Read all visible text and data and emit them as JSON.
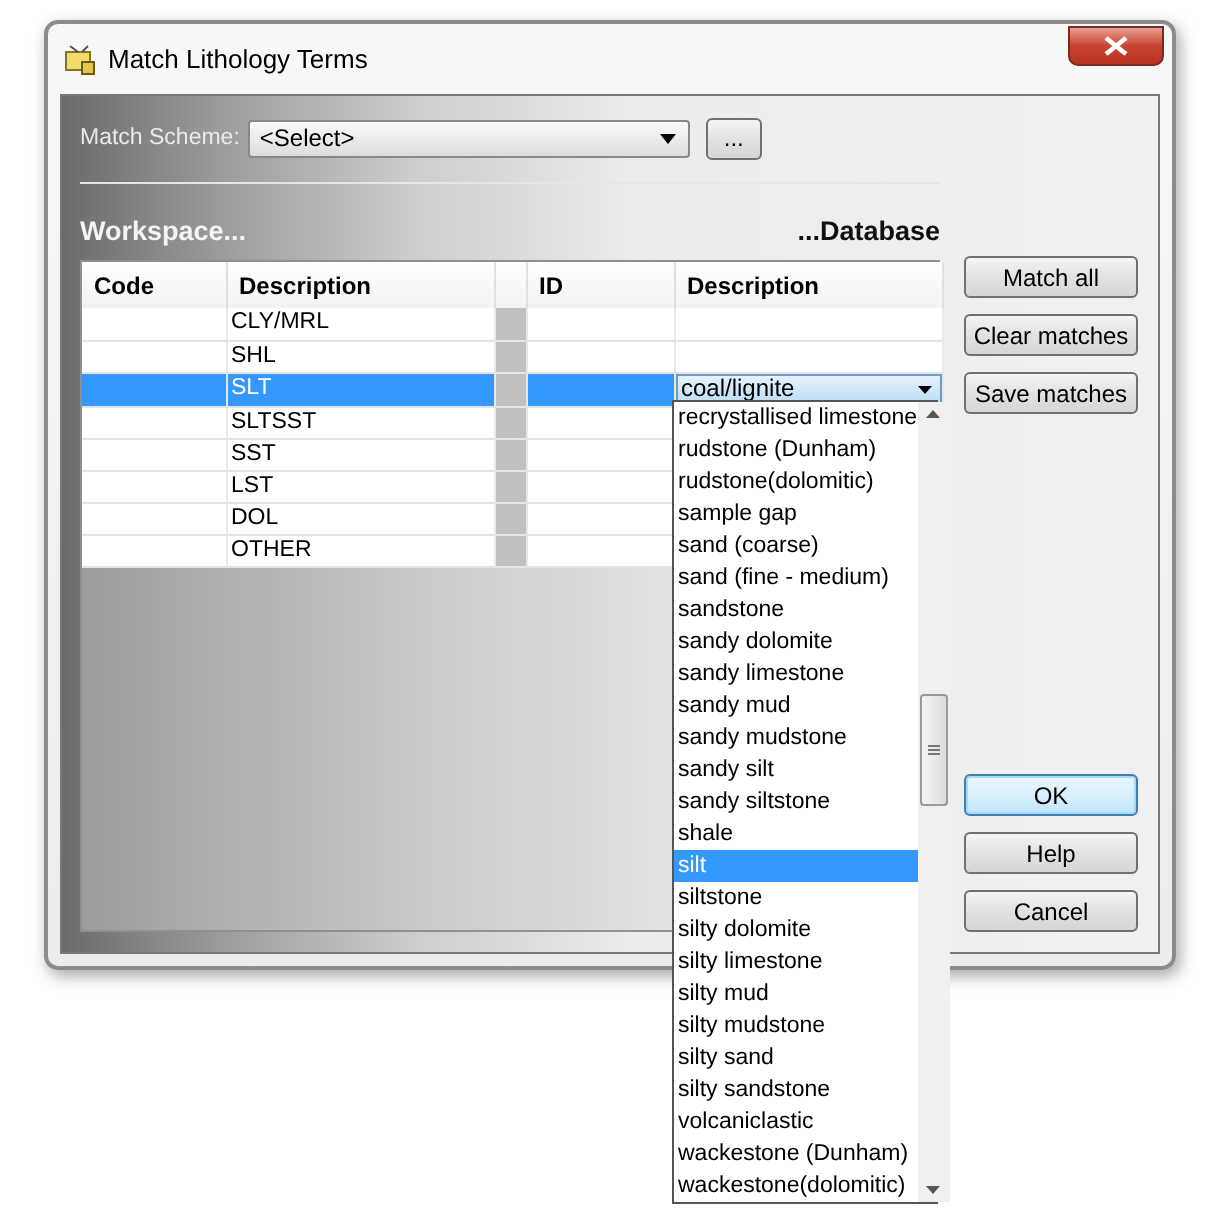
{
  "window": {
    "title": "Match Lithology Terms"
  },
  "match_scheme": {
    "label": "Match Scheme:",
    "value": "<Select>",
    "browse_button": "..."
  },
  "headings": {
    "workspace": "Workspace...",
    "database": "...Database"
  },
  "table": {
    "columns": [
      {
        "label": "Code"
      },
      {
        "label": "Description"
      },
      {
        "label": "ID"
      },
      {
        "label": "Description"
      }
    ],
    "rows": [
      {
        "description": "CLY/MRL",
        "selected": false
      },
      {
        "description": "SHL",
        "selected": false
      },
      {
        "description": "SLT",
        "selected": true,
        "db_description": "coal/lignite"
      },
      {
        "description": "SLTSST",
        "selected": false
      },
      {
        "description": "SST",
        "selected": false
      },
      {
        "description": "LST",
        "selected": false
      },
      {
        "description": "DOL",
        "selected": false
      },
      {
        "description": "OTHER",
        "selected": false
      }
    ]
  },
  "dropdown": {
    "items": [
      {
        "label": "recrystallised limestone",
        "selected": false
      },
      {
        "label": "rudstone (Dunham)",
        "selected": false
      },
      {
        "label": "rudstone(dolomitic)",
        "selected": false
      },
      {
        "label": "sample gap",
        "selected": false
      },
      {
        "label": "sand (coarse)",
        "selected": false
      },
      {
        "label": "sand (fine - medium)",
        "selected": false
      },
      {
        "label": "sandstone",
        "selected": false
      },
      {
        "label": "sandy dolomite",
        "selected": false
      },
      {
        "label": "sandy limestone",
        "selected": false
      },
      {
        "label": "sandy mud",
        "selected": false
      },
      {
        "label": "sandy mudstone",
        "selected": false
      },
      {
        "label": "sandy silt",
        "selected": false
      },
      {
        "label": "sandy siltstone",
        "selected": false
      },
      {
        "label": "shale",
        "selected": false
      },
      {
        "label": "silt",
        "selected": true
      },
      {
        "label": "siltstone",
        "selected": false
      },
      {
        "label": "silty dolomite",
        "selected": false
      },
      {
        "label": "silty limestone",
        "selected": false
      },
      {
        "label": "silty mud",
        "selected": false
      },
      {
        "label": "silty mudstone",
        "selected": false
      },
      {
        "label": "silty sand",
        "selected": false
      },
      {
        "label": "silty sandstone",
        "selected": false
      },
      {
        "label": "volcaniclastic",
        "selected": false
      },
      {
        "label": "wackestone (Dunham)",
        "selected": false
      },
      {
        "label": "wackestone(dolomitic)",
        "selected": false
      }
    ]
  },
  "side_buttons": [
    {
      "label": "Match all",
      "default": false
    },
    {
      "label": "Clear matches",
      "default": false
    },
    {
      "label": "Save matches",
      "default": false
    }
  ],
  "dialog_buttons": [
    {
      "label": "OK",
      "default": true
    },
    {
      "label": "Help",
      "default": false
    },
    {
      "label": "Cancel",
      "default": false
    }
  ]
}
